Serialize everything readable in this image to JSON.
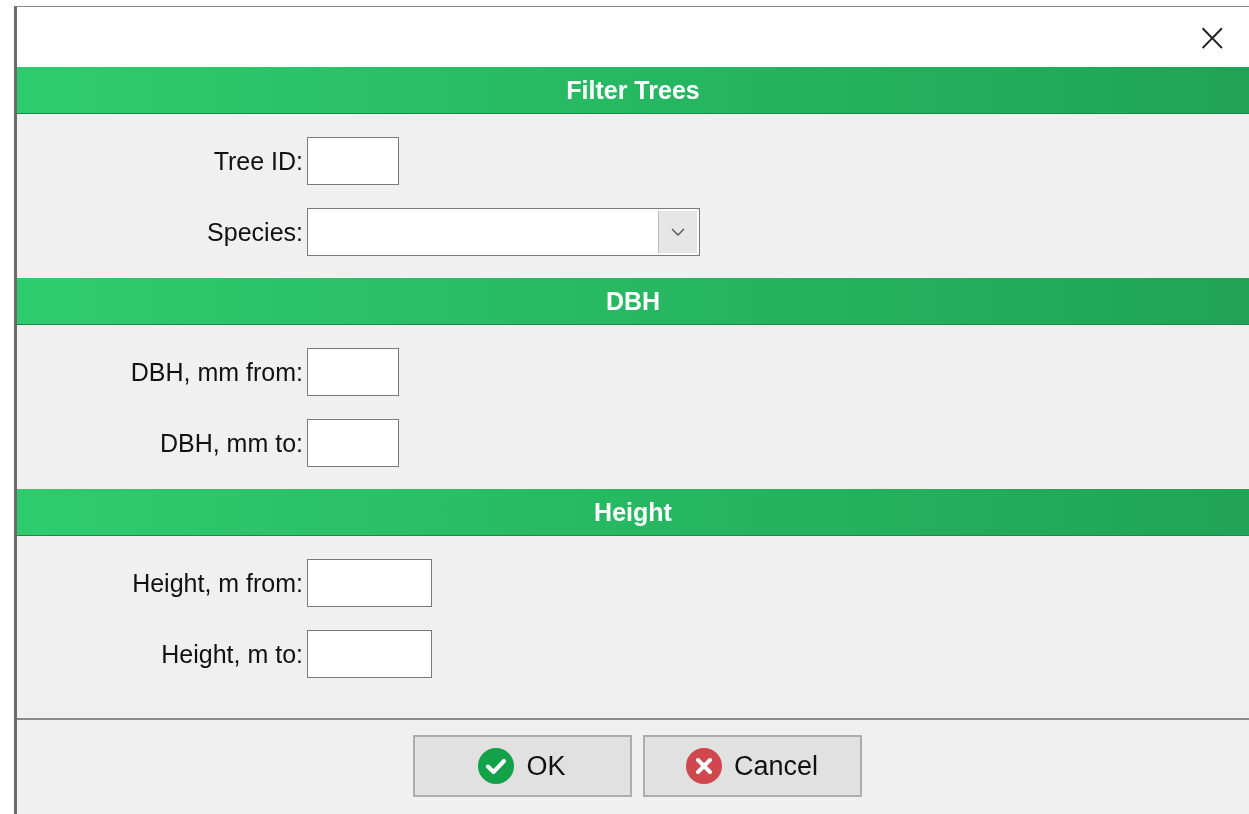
{
  "window": {
    "close": "×"
  },
  "sections": [
    {
      "title": "Filter Trees",
      "fields": [
        {
          "label": "Tree ID:",
          "kind": "short"
        },
        {
          "label": "Species:",
          "kind": "dropdown"
        }
      ]
    },
    {
      "title": "DBH",
      "fields": [
        {
          "label": "DBH, mm from:",
          "kind": "short"
        },
        {
          "label": "DBH, mm to:",
          "kind": "short"
        }
      ]
    },
    {
      "title": "Height",
      "fields": [
        {
          "label": "Height, m from:",
          "kind": "medium"
        },
        {
          "label": "Height, m to:",
          "kind": "medium"
        }
      ]
    }
  ],
  "buttons": [
    {
      "label": "OK",
      "kind": "ok"
    },
    {
      "label": "Cancel",
      "kind": "cancel"
    }
  ]
}
